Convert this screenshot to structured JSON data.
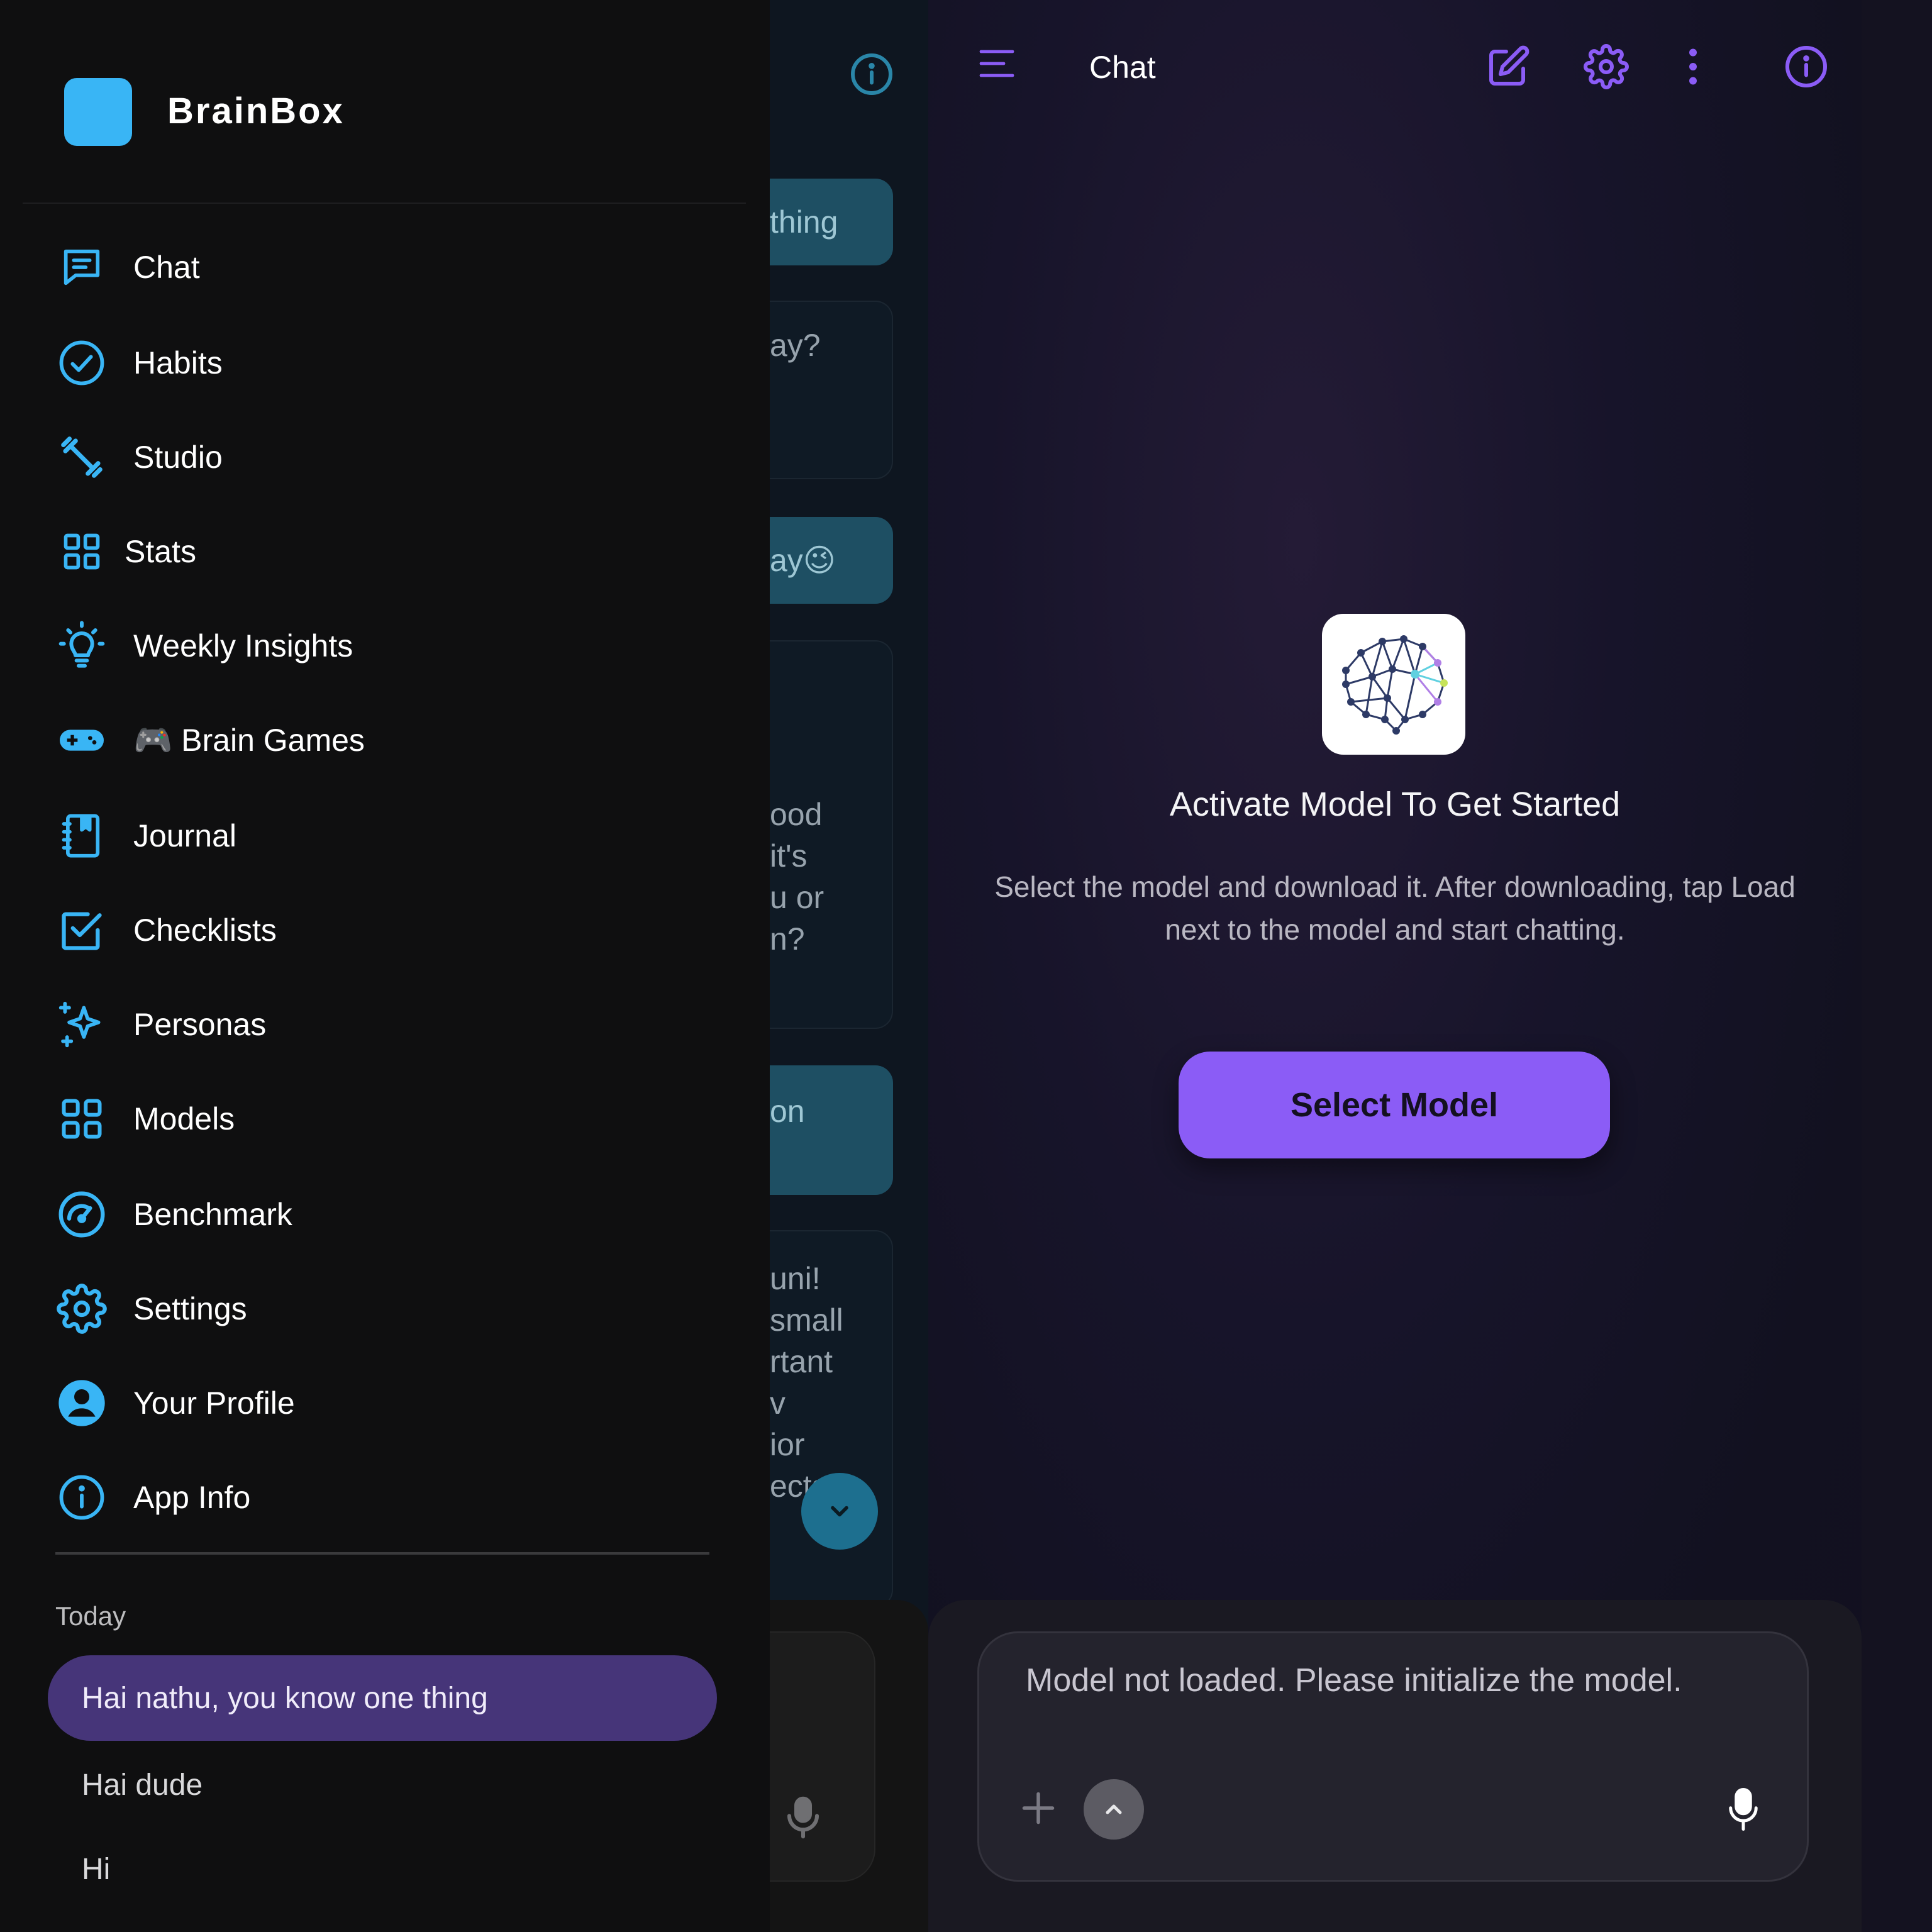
{
  "drawer": {
    "brand_name": "BrainBox",
    "nav": [
      {
        "label": "Chat",
        "icon": "chat-icon"
      },
      {
        "label": "Habits",
        "icon": "check-circle-icon"
      },
      {
        "label": "Studio",
        "icon": "dumbbell-icon"
      },
      {
        "label": "Stats",
        "icon": "grid-icon"
      },
      {
        "label": "Weekly Insights",
        "icon": "lightbulb-icon"
      },
      {
        "label": "🎮 Brain Games",
        "icon": "gamepad-icon"
      },
      {
        "label": "Journal",
        "icon": "notebook-icon"
      },
      {
        "label": "Checklists",
        "icon": "checkbox-icon"
      },
      {
        "label": "Personas",
        "icon": "sparkles-icon"
      },
      {
        "label": "Models",
        "icon": "grid-icon"
      },
      {
        "label": "Benchmark",
        "icon": "speedometer-icon"
      },
      {
        "label": "Settings",
        "icon": "gear-icon"
      },
      {
        "label": "Your Profile",
        "icon": "user-circle-icon"
      },
      {
        "label": "App Info",
        "icon": "info-icon"
      }
    ],
    "history_section": "Today",
    "history": [
      {
        "title": "Hai nathu, you know one thing",
        "active": true
      },
      {
        "title": "Hai dude",
        "active": false
      },
      {
        "title": "Hi",
        "active": false
      }
    ]
  },
  "background_chat": {
    "fragments": [
      "thing",
      "ay?",
      "ay😉",
      "ood",
      "it's",
      "u or",
      "n?",
      "on",
      "uni!",
      "small",
      "rtant",
      "v",
      "ior",
      "ects"
    ]
  },
  "chat": {
    "title": "Chat",
    "empty_heading": "Activate Model To Get Started",
    "empty_text": "Select the model and download it. After downloading, tap Load next to the model and start chatting.",
    "select_model_label": "Select Model",
    "input_placeholder": "Model not loaded. Please initialize the model."
  },
  "colors": {
    "accent_blue": "#39b5f5",
    "accent_purple": "#8b5cf6",
    "active_history": "#463579"
  }
}
